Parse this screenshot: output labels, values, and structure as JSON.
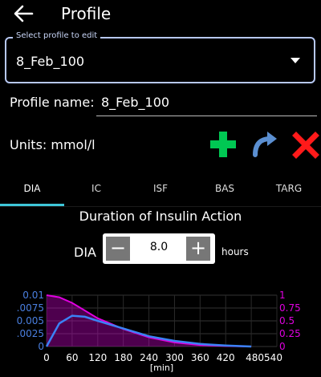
{
  "header": {
    "title": "Profile"
  },
  "profile_select": {
    "label": "Select profile to edit",
    "value": "8_Feb_100"
  },
  "profile_name": {
    "label": "Profile name:",
    "value": "8_Feb_100"
  },
  "units": {
    "label": "Units: mmol/l"
  },
  "tabs": [
    {
      "label": "DIA",
      "active": true
    },
    {
      "label": "IC",
      "active": false
    },
    {
      "label": "ISF",
      "active": false
    },
    {
      "label": "BAS",
      "active": false
    },
    {
      "label": "TARG",
      "active": false
    }
  ],
  "dia": {
    "title": "Duration of Insulin Action",
    "label": "DIA",
    "value": "8.0",
    "unit": "hours",
    "minus": "−",
    "plus": "+"
  },
  "colors": {
    "accent": "#3ec6d8",
    "add": "#00c853",
    "delete": "#ff1a1a",
    "clone": "#5b8fd1",
    "iob": "#e000e0",
    "activity": "#3b82f6"
  },
  "chart_data": {
    "type": "area",
    "x": [
      0,
      30,
      60,
      90,
      120,
      180,
      240,
      300,
      360,
      420,
      480
    ],
    "series": [
      {
        "values": [
          1.0,
          0.96,
          0.85,
          0.7,
          0.55,
          0.34,
          0.18,
          0.08,
          0.03,
          0.01,
          0.0
        ]
      },
      {
        "values": [
          0.0,
          0.0045,
          0.006,
          0.0058,
          0.005,
          0.0035,
          0.002,
          0.0011,
          0.0005,
          0.0002,
          0.0
        ]
      }
    ],
    "xticks": [
      "0",
      "60",
      "120",
      "180",
      "240",
      "300",
      "360",
      "420",
      "480540"
    ],
    "xlabel": "[min]",
    "ylabel_left": [
      "0.01",
      ".0075",
      "0.005",
      ".0025",
      "0"
    ],
    "ylabel_right": [
      "1",
      "0.75",
      "0.5",
      "0.25",
      "0"
    ],
    "ylim_left": [
      0,
      0.01
    ],
    "ylim_right": [
      0,
      1
    ],
    "xlim": [
      0,
      540
    ]
  }
}
